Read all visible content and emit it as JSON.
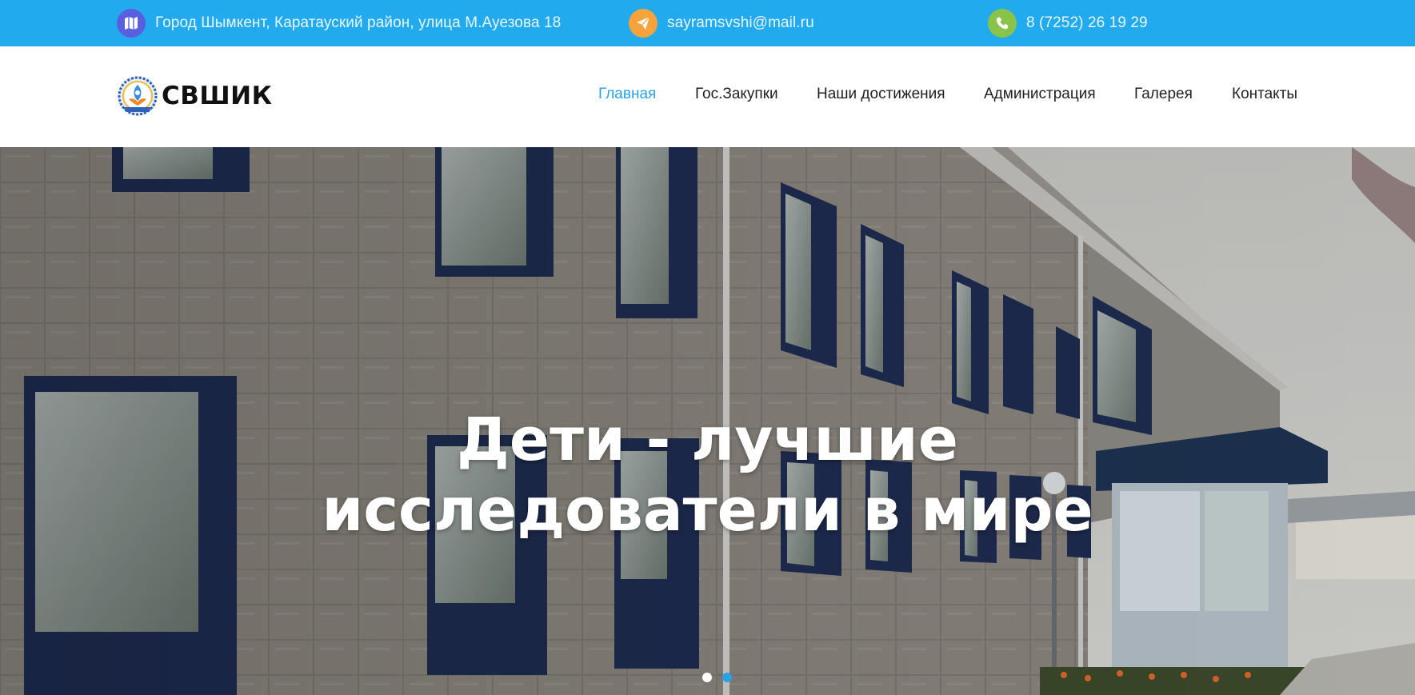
{
  "topbar": {
    "address": "Город Шымкент, Каратауский район, улица М.Ауезова 18",
    "email": "sayramsvshi@mail.ru",
    "phone": "8 (7252) 26 19 29",
    "icons": {
      "address": "map-icon",
      "email": "send-icon",
      "phone": "phone-icon"
    },
    "colors": {
      "bar": "#22aaee",
      "map": "#5a5fe0",
      "mail": "#f5a33a",
      "phone": "#8ac349"
    }
  },
  "header": {
    "brand": "СВШИК",
    "nav": [
      {
        "label": "Главная",
        "active": true
      },
      {
        "label": "Гос.Закупки",
        "active": false
      },
      {
        "label": "Наши достижения",
        "active": false
      },
      {
        "label": "Администрация",
        "active": false
      },
      {
        "label": "Галерея",
        "active": false
      },
      {
        "label": "Контакты",
        "active": false
      }
    ],
    "active_color": "#2aa3e6"
  },
  "hero": {
    "title_line1": "Дети - лучшие",
    "title_line2": "исследователи в мире",
    "slides": 2,
    "current_slide": 2
  }
}
